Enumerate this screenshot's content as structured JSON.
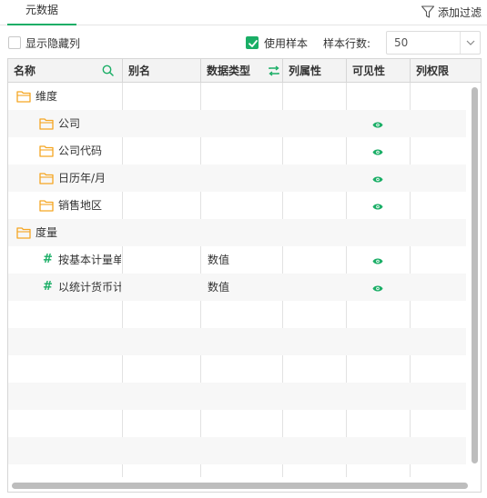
{
  "tabs": [
    {
      "label": "元数据",
      "active": true
    }
  ],
  "toolbar": {
    "add_filter_label": "添加过滤"
  },
  "options": {
    "show_hidden_label": "显示隐藏列",
    "show_hidden_checked": false,
    "use_sample_label": "使用样本",
    "use_sample_checked": true,
    "sample_rows_label": "样本行数:",
    "sample_rows_value": "50"
  },
  "columns": [
    {
      "label": "名称",
      "icon": "search-icon"
    },
    {
      "label": "别名"
    },
    {
      "label": "数据类型",
      "icon": "swap-icon"
    },
    {
      "label": "列属性"
    },
    {
      "label": "可见性"
    },
    {
      "label": "列权限"
    }
  ],
  "rows": [
    {
      "name": "维度",
      "type": "",
      "kind": "folder",
      "level": 0,
      "visible": false
    },
    {
      "name": "公司",
      "type": "",
      "kind": "folder",
      "level": 1,
      "visible": true
    },
    {
      "name": "公司代码",
      "type": "",
      "kind": "folder",
      "level": 1,
      "visible": true
    },
    {
      "name": "日历年/月",
      "type": "",
      "kind": "folder",
      "level": 1,
      "visible": true
    },
    {
      "name": "销售地区",
      "type": "",
      "kind": "folder",
      "level": 1,
      "visible": true
    },
    {
      "name": "度量",
      "type": "",
      "kind": "folder",
      "level": 0,
      "visible": false
    },
    {
      "name": "按基本计量单",
      "type": "数值",
      "kind": "measure",
      "level": 1,
      "visible": true
    },
    {
      "name": "以统计货币计",
      "type": "数值",
      "kind": "measure",
      "level": 1,
      "visible": true
    }
  ],
  "colors": {
    "accent": "#1aae66",
    "folder": "#f5a623",
    "header_bg": "#f3f3f3",
    "alt_row": "#f7f7f7"
  }
}
